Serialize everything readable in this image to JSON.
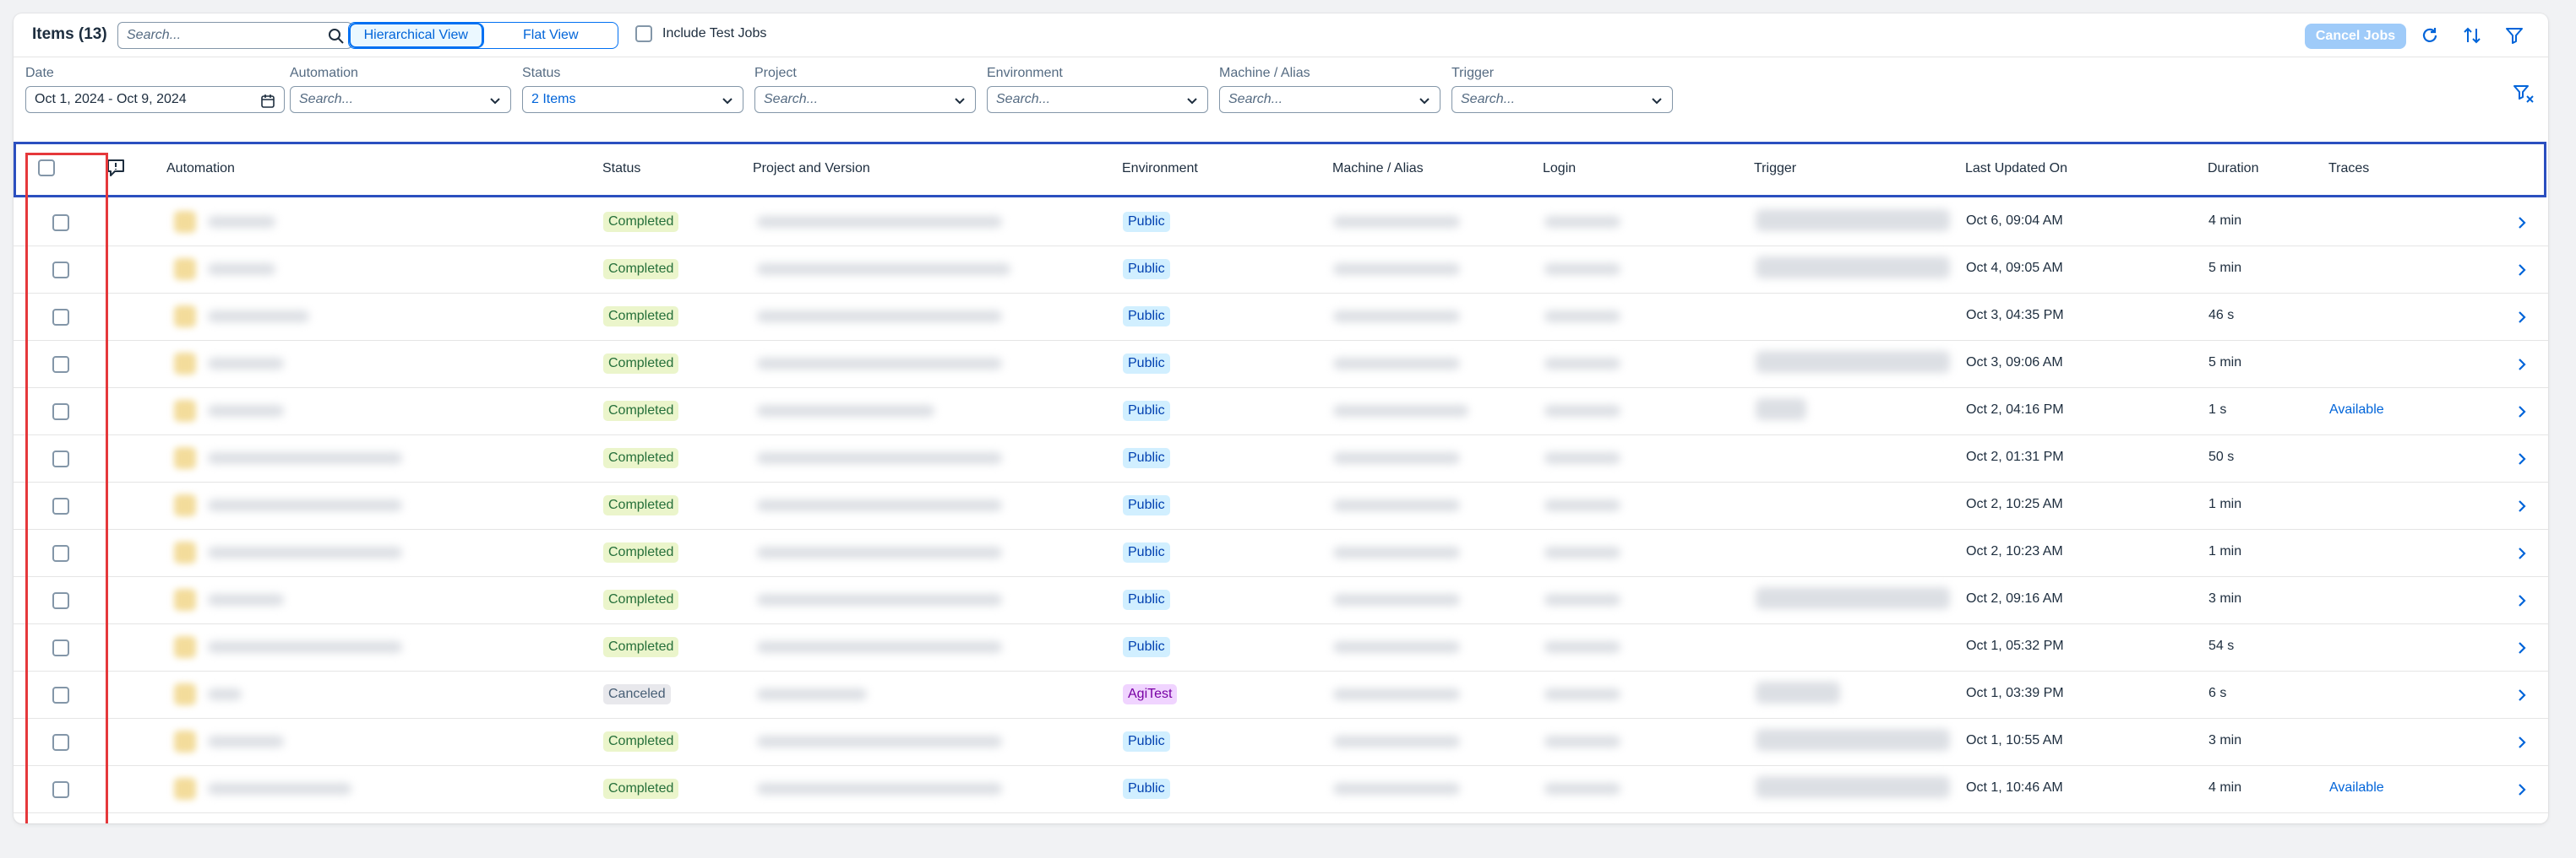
{
  "toolbar": {
    "title": "Items (13)",
    "search_placeholder": "Search...",
    "views": [
      "Hierarchical View",
      "Flat View"
    ],
    "include_test_jobs": "Include Test Jobs",
    "cancel_jobs": "Cancel Jobs"
  },
  "filters": [
    {
      "label": "Date",
      "value": "Oct 1, 2024 - Oct 9, 2024",
      "type": "date"
    },
    {
      "label": "Automation",
      "placeholder": "Search..."
    },
    {
      "label": "Status",
      "value": "2 Items"
    },
    {
      "label": "Project",
      "placeholder": "Search..."
    },
    {
      "label": "Environment",
      "placeholder": "Search..."
    },
    {
      "label": "Machine / Alias",
      "placeholder": "Search..."
    },
    {
      "label": "Trigger",
      "placeholder": "Search..."
    }
  ],
  "columns": [
    "Automation",
    "Status",
    "Project and Version",
    "Environment",
    "Machine / Alias",
    "Login",
    "Trigger",
    "Last Updated On",
    "Duration",
    "Traces"
  ],
  "rows": [
    {
      "status": "Completed",
      "environment": "Public",
      "updated": "Oct 6, 09:04 AM",
      "duration": "4 min",
      "traces": ""
    },
    {
      "status": "Completed",
      "environment": "Public",
      "updated": "Oct 4, 09:05 AM",
      "duration": "5 min",
      "traces": ""
    },
    {
      "status": "Completed",
      "environment": "Public",
      "updated": "Oct 3, 04:35 PM",
      "duration": "46 s",
      "traces": ""
    },
    {
      "status": "Completed",
      "environment": "Public",
      "updated": "Oct 3, 09:06 AM",
      "duration": "5 min",
      "traces": ""
    },
    {
      "status": "Completed",
      "environment": "Public",
      "updated": "Oct 2, 04:16 PM",
      "duration": "1 s",
      "traces": "Available"
    },
    {
      "status": "Completed",
      "environment": "Public",
      "updated": "Oct 2, 01:31 PM",
      "duration": "50 s",
      "traces": ""
    },
    {
      "status": "Completed",
      "environment": "Public",
      "updated": "Oct 2, 10:25 AM",
      "duration": "1 min",
      "traces": ""
    },
    {
      "status": "Completed",
      "environment": "Public",
      "updated": "Oct 2, 10:23 AM",
      "duration": "1 min",
      "traces": ""
    },
    {
      "status": "Completed",
      "environment": "Public",
      "updated": "Oct 2, 09:16 AM",
      "duration": "3 min",
      "traces": ""
    },
    {
      "status": "Completed",
      "environment": "Public",
      "updated": "Oct 1, 05:32 PM",
      "duration": "54 s",
      "traces": ""
    },
    {
      "status": "Canceled",
      "environment": "AgiTest",
      "updated": "Oct 1, 03:39 PM",
      "duration": "6 s",
      "traces": ""
    },
    {
      "status": "Completed",
      "environment": "Public",
      "updated": "Oct 1, 10:55 AM",
      "duration": "3 min",
      "traces": ""
    },
    {
      "status": "Completed",
      "environment": "Public",
      "updated": "Oct 1, 10:46 AM",
      "duration": "4 min",
      "traces": "Available"
    }
  ],
  "colors": {
    "accent": "#0070f2",
    "highlight": "#e5383b",
    "header_border": "#2b4fbf"
  }
}
